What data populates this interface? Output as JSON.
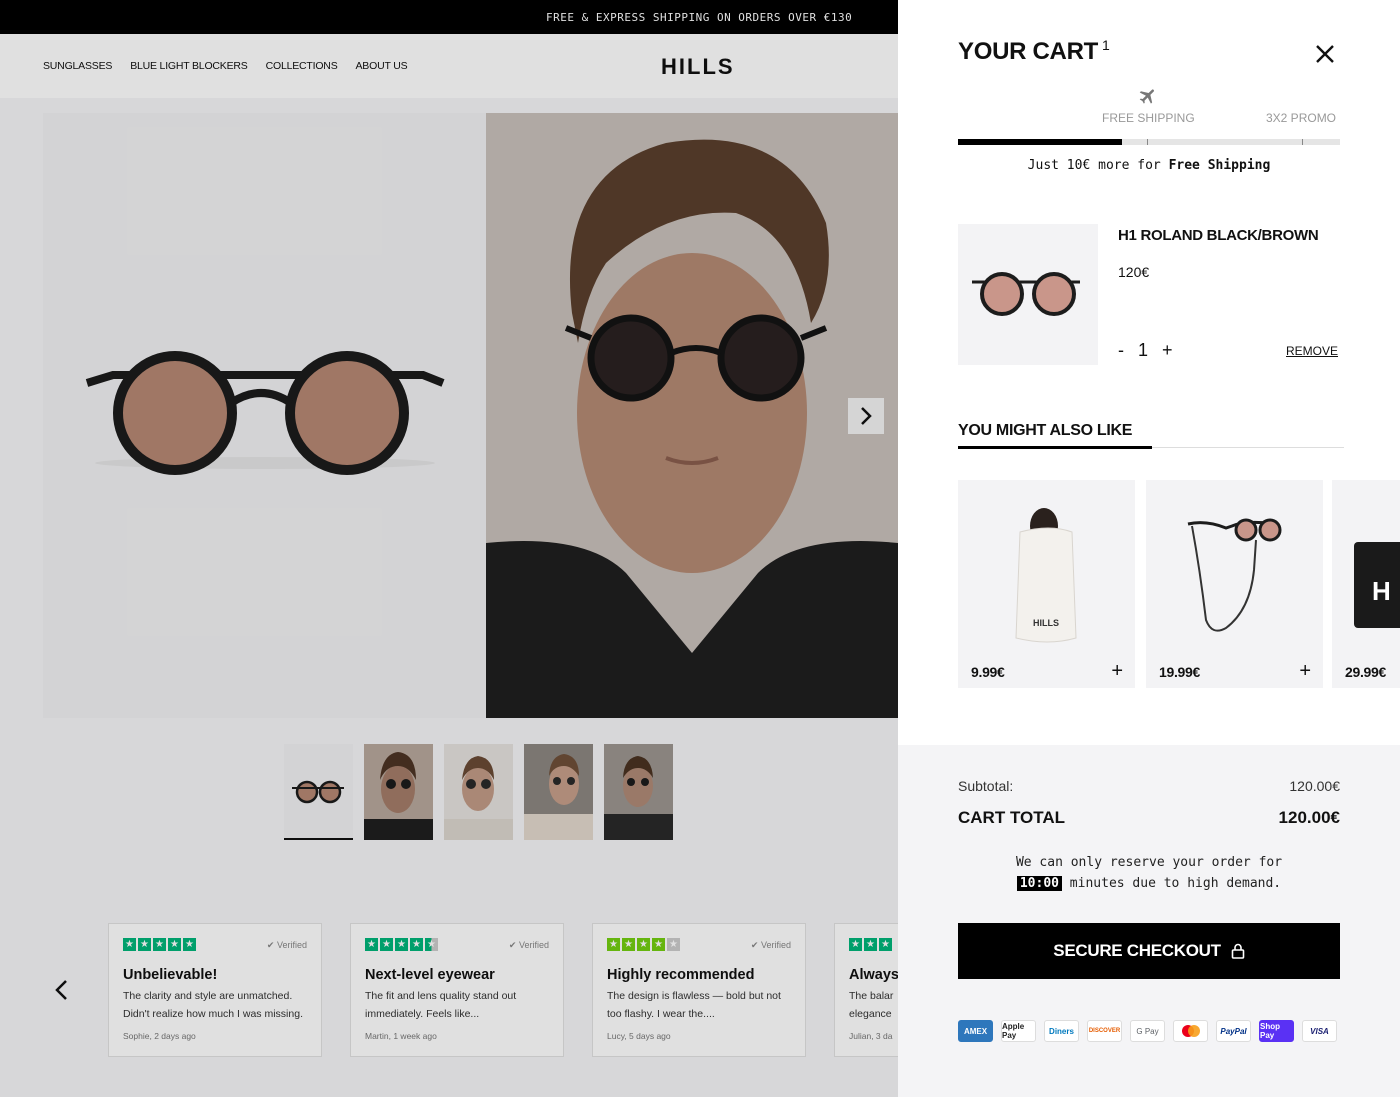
{
  "store": {
    "announcement": "FREE & EXPRESS SHIPPING ON ORDERS OVER €130",
    "nav": [
      "SUNGLASSES",
      "BLUE LIGHT BLOCKERS",
      "COLLECTIONS",
      "ABOUT US"
    ],
    "brand": "HILLS",
    "reviews": [
      {
        "title": "Unbelievable!",
        "text": "The clarity and style are unmatched. Didn't realize how much I was missing.",
        "meta": "Sophie, 2 days ago",
        "verified": "Verified",
        "rating": 5
      },
      {
        "title": "Next-level eyewear",
        "text": "The fit and lens quality stand out immediately. Feels like...",
        "meta": "Martin, 1 week ago",
        "verified": "Verified",
        "rating": 4.5
      },
      {
        "title": "Highly recommended",
        "text": "The design is flawless — bold but not too flashy. I wear the....",
        "meta": "Lucy, 5 days ago",
        "verified": "Verified",
        "rating": 4
      },
      {
        "title": "Always",
        "text": "The balar elegance",
        "meta": "Julian, 3 da",
        "verified": "",
        "rating": 3
      }
    ]
  },
  "cart": {
    "title": "YOUR CART",
    "count": "1",
    "shipping": {
      "milestone1": "FREE SHIPPING",
      "milestone2": "3X2 PROMO",
      "progress": 0.43,
      "message_prefix": "Just 10€ more for ",
      "message_bold": "Free Shipping"
    },
    "item": {
      "name": "H1 ROLAND BLACK/BROWN",
      "price": "120€",
      "qty": "1",
      "minus": "-",
      "plus": "+",
      "remove": "REMOVE"
    },
    "recommendations": {
      "title": "YOU MIGHT ALSO LIKE",
      "items": [
        {
          "price": "9.99€",
          "add": "+",
          "label": "HILLS"
        },
        {
          "price": "19.99€",
          "add": "+"
        },
        {
          "price": "29.99€",
          "label": "H"
        }
      ]
    },
    "summary": {
      "subtotal_label": "Subtotal:",
      "subtotal_value": "120.00€",
      "total_label": "CART TOTAL",
      "total_value": "120.00€",
      "reserve_text_1": "We can only reserve your order for",
      "timer": "10:00",
      "reserve_text_2": " minutes due to high demand.",
      "checkout_label": "SECURE CHECKOUT"
    },
    "payment_methods": [
      "AMEX",
      "Apple Pay",
      "Diners",
      "DISCOVER",
      "G Pay",
      "Mastercard",
      "PayPal",
      "Shop Pay",
      "VISA"
    ]
  }
}
